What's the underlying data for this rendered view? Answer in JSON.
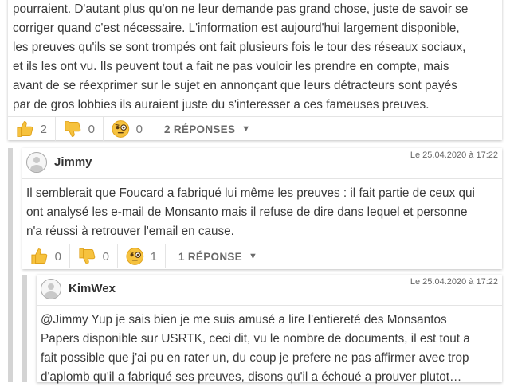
{
  "comment_top": {
    "lines": [
      "pourraient. D'autant plus qu'on ne leur demande pas grand chose, juste de savoir se",
      "corriger quand c'est nécessaire. L'information est aujourd'hui largement disponible,",
      "les preuves qu'ils se sont trompés ont fait plusieurs fois le tour des réseaux sociaux,",
      "et ils les ont vu. Ils peuvent tout a fait ne pas vouloir les prendre en compte, mais",
      "avant de se réexprimer sur le sujet en annonçant que leurs détracteurs sont payés",
      "par de gros lobbies ils auraient juste du s'interesser a ces fameuses preuves."
    ],
    "reactions": {
      "like": "2",
      "dislike": "0",
      "doubt": "0"
    },
    "replies_label": "2 RÉPONSES",
    "caret": "▼"
  },
  "reply_jimmy": {
    "author": "Jimmy",
    "date": "Le 25.04.2020 à 17:22",
    "lines": [
      "Il semblerait que Foucard a fabriqué lui même les preuves : il fait partie de ceux qui",
      "ont analysé les e-mail de Monsanto mais il refuse de dire dans lequel et personne",
      "n'a réussi à retrouver l'email en cause."
    ],
    "reactions": {
      "like": "0",
      "dislike": "0",
      "doubt": "1"
    },
    "replies_label": "1 RÉPONSE",
    "caret": "▼"
  },
  "reply_kimwex": {
    "author": "KimWex",
    "date": "Le 25.04.2020 à 17:22",
    "lines": [
      "@Jimmy Yup je sais bien je me suis amusé a lire l'entiereté des Monsantos",
      "Papers disponible sur USRTK, ceci dit, vu le nombre de documents, il est tout a",
      "fait possible que j'ai pu en rater un, du coup je prefere ne pas affirmer avec trop",
      "d'aplomb qu'il a fabriqué ses preuves, disons qu'il a échoué a prouver plutot…"
    ]
  },
  "icons": {
    "like": "thumbs-up-icon",
    "dislike": "thumbs-down-icon",
    "doubt": "monocle-face-icon",
    "avatar": "default-avatar-icon"
  },
  "colors": {
    "emoji_yellow": "#f6c23e",
    "emoji_outline": "#e0a21a",
    "gutter": "#d4d4d4",
    "border": "#e4e4e4"
  }
}
